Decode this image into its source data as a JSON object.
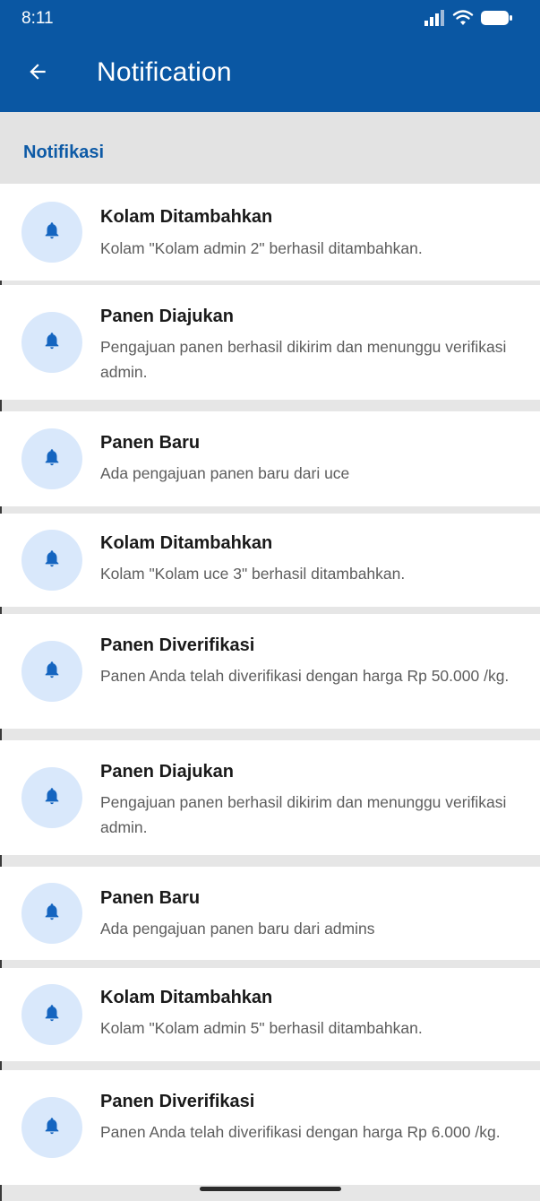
{
  "status_bar": {
    "time": "8:11",
    "icons": [
      "signal-icon",
      "wifi-icon",
      "battery-icon"
    ]
  },
  "app_bar": {
    "back_icon": "arrow-back-icon",
    "title": "Notification"
  },
  "section": {
    "title": "Notifikasi"
  },
  "notifications": [
    {
      "title": "Kolam Ditambahkan",
      "message": "Kolam \"Kolam admin 2\" berhasil ditambahkan.",
      "icon": "bell-icon"
    },
    {
      "title": "Panen Diajukan",
      "message": "Pengajuan panen berhasil dikirim dan menunggu verifikasi admin.",
      "icon": "bell-icon"
    },
    {
      "title": "Panen Baru",
      "message": "Ada pengajuan panen baru dari uce",
      "icon": "bell-icon"
    },
    {
      "title": "Kolam Ditambahkan",
      "message": "Kolam \"Kolam uce 3\" berhasil ditambahkan.",
      "icon": "bell-icon"
    },
    {
      "title": "Panen Diverifikasi",
      "message": "Panen Anda telah diverifikasi dengan harga Rp 50.000 /kg.",
      "icon": "bell-icon"
    },
    {
      "title": "Panen Diajukan",
      "message": "Pengajuan panen berhasil dikirim dan menunggu verifikasi admin.",
      "icon": "bell-icon"
    },
    {
      "title": "Panen Baru",
      "message": "Ada pengajuan panen baru dari admins",
      "icon": "bell-icon"
    },
    {
      "title": "Kolam Ditambahkan",
      "message": "Kolam \"Kolam admin 5\" berhasil ditambahkan.",
      "icon": "bell-icon"
    },
    {
      "title": "Panen Diverifikasi",
      "message": "Panen Anda telah diverifikasi dengan harga Rp 6.000 /kg.",
      "icon": "bell-icon"
    }
  ],
  "colors": {
    "primary": "#0a57a3",
    "section_title": "#0d5aa6",
    "icon_bg": "#d9e8fb",
    "icon": "#1565c0",
    "divider": "#e6e6e6"
  }
}
